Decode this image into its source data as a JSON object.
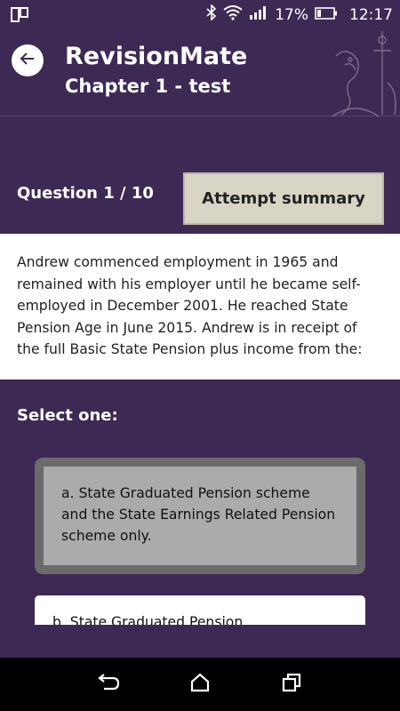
{
  "status_bar": {
    "battery_percent": "17%",
    "time": "12:17"
  },
  "app_bar": {
    "title": "RevisionMate",
    "subtitle": "Chapter 1 - test"
  },
  "question": {
    "counter": "Question 1 / 10",
    "summary_button": "Attempt summary",
    "text": "Andrew commenced employment in 1965 and remained with his employer until he became self-employed in December 2001. He reached State Pension Age in June 2015. Andrew is in receipt of the full Basic State Pension plus income from the:",
    "select_prompt": "Select one:"
  },
  "options": [
    {
      "label": "a. State Graduated Pension scheme and the State Earnings Related Pension scheme only.",
      "selected": true
    },
    {
      "label": "b. State Graduated Pension",
      "selected": false
    }
  ],
  "colors": {
    "background": "#3d2a54",
    "summary_button": "#d9d5c6",
    "selected_option": "#ababab"
  }
}
